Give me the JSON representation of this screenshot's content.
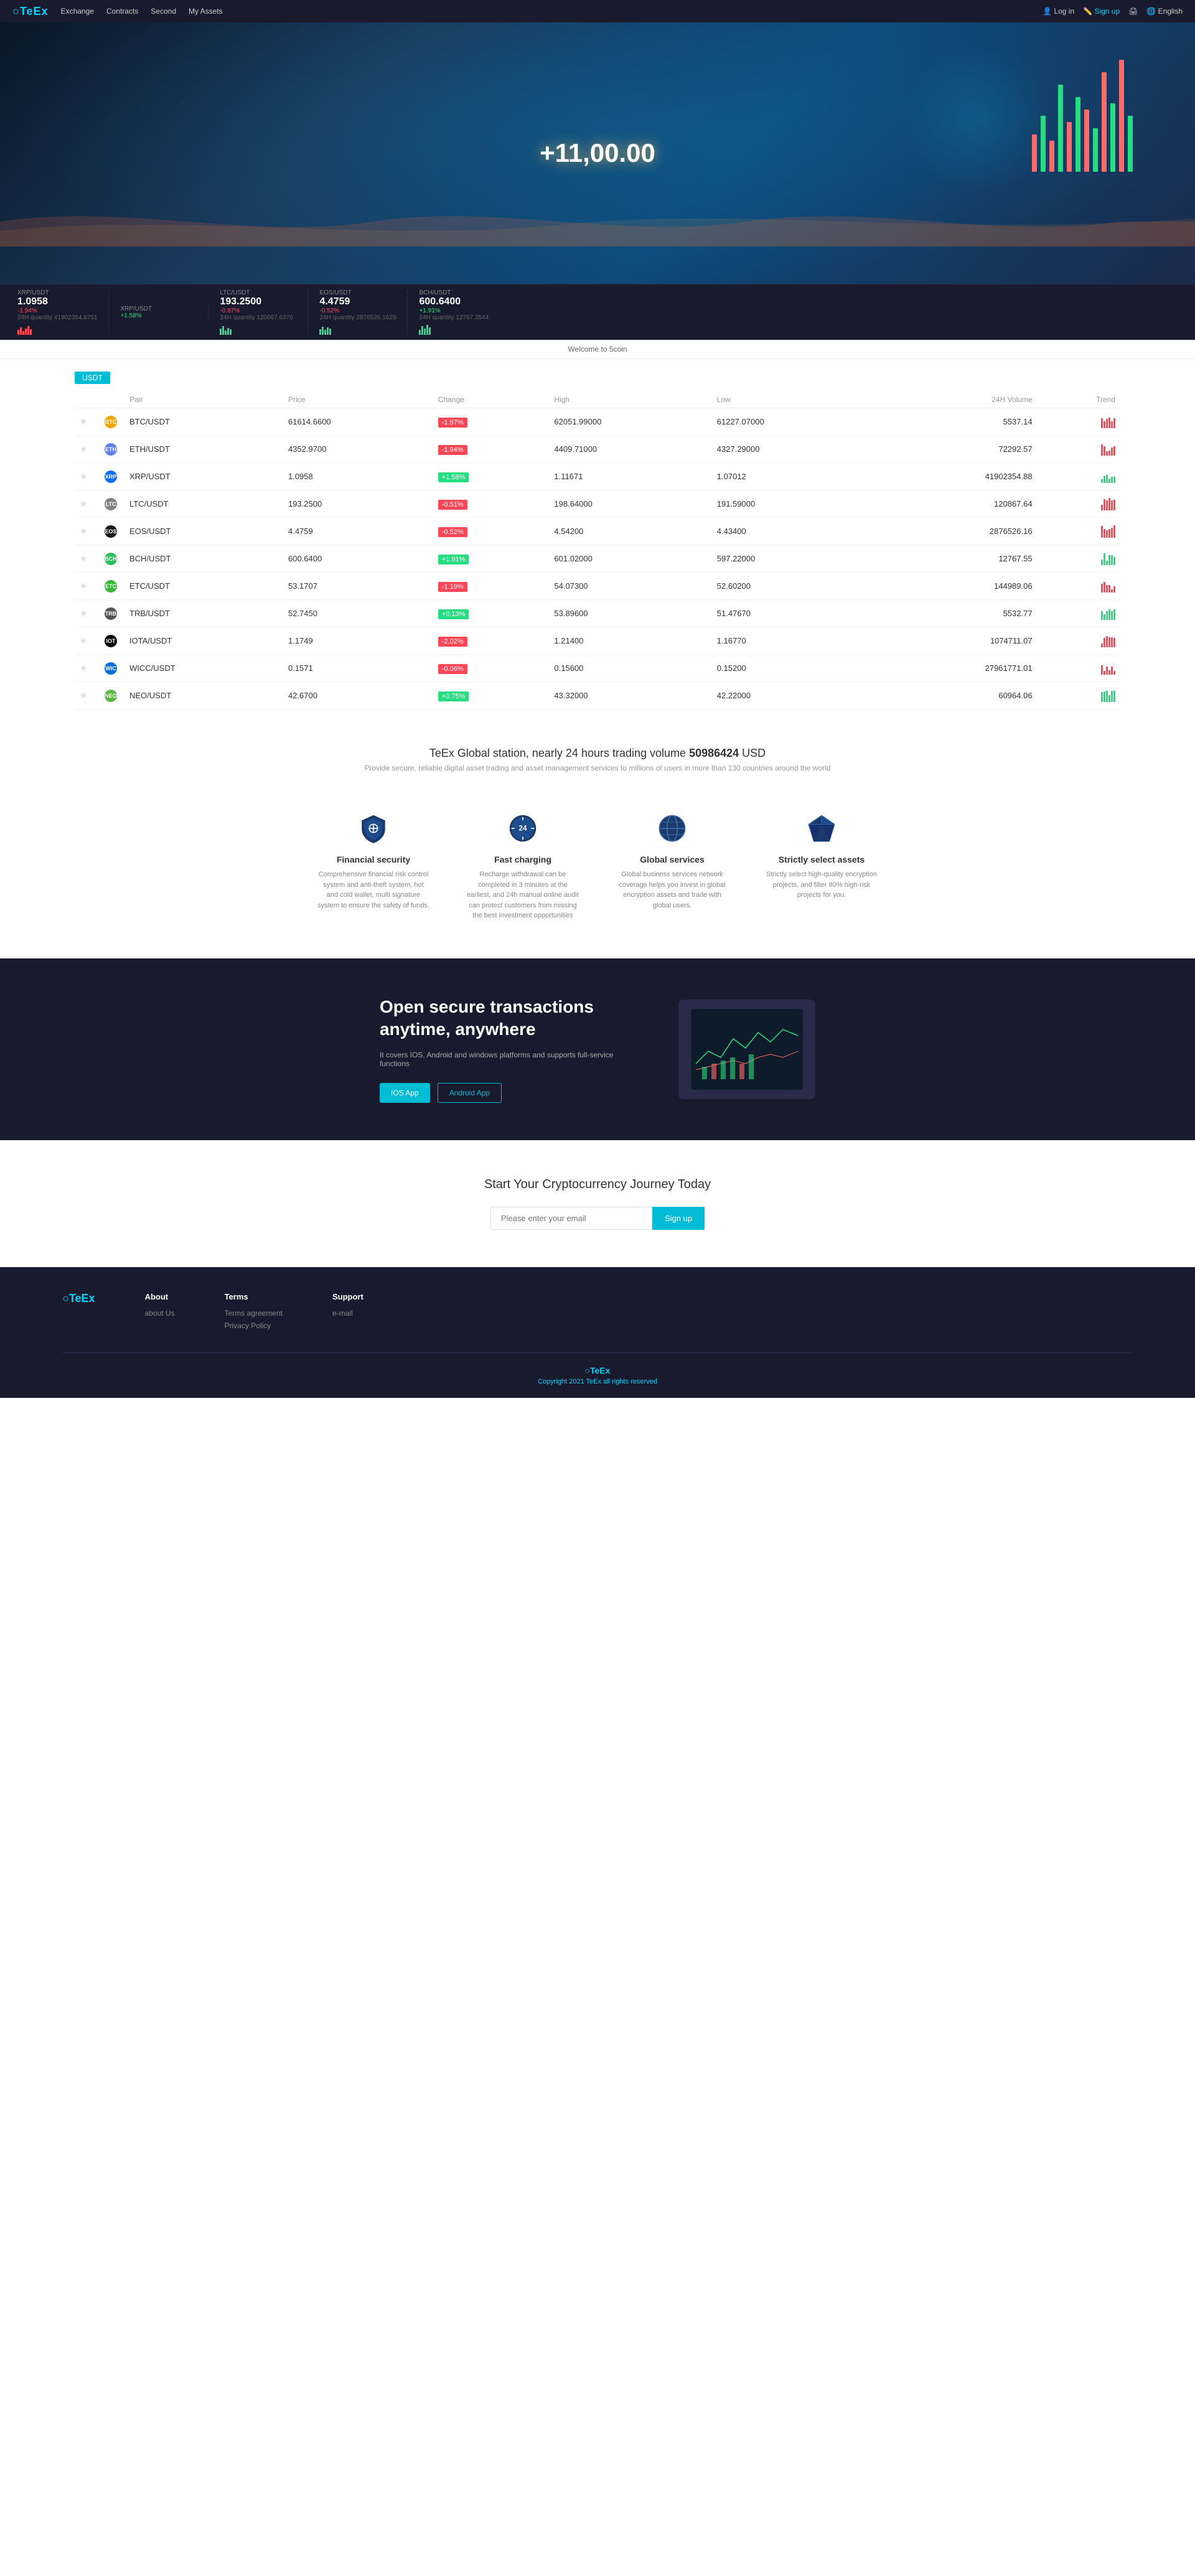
{
  "brand": {
    "logo": "○TeEx",
    "logo_colored": "TeEx"
  },
  "navbar": {
    "links": [
      "Exchange",
      "Contracts",
      "Second",
      "My Assets"
    ],
    "login": "Log in",
    "signup": "Sign up",
    "print": "🖨",
    "lang": "🌐 English"
  },
  "ticker": [
    {
      "pair": "XRP/USDT",
      "change": "-1.94%",
      "price": "1.0958",
      "vol": "24H quantity 41902354.6751",
      "pos": false
    },
    {
      "pair": "XRP/USDT",
      "change": "+1.58%",
      "price": "",
      "vol": "",
      "pos": true
    },
    {
      "pair": "LTC/USDT",
      "change": "-0.87%",
      "price": "193.2500",
      "vol": "24H quantity 120667.6376",
      "pos": false
    },
    {
      "pair": "EOS/USDT",
      "change": "-0.52%",
      "price": "4.4759",
      "vol": "24H quantity 2876526.1629",
      "pos": false
    },
    {
      "pair": "BCH/USDT",
      "change": "+1.91%",
      "price": "600.6400",
      "vol": "24H quantity 12767.3544",
      "pos": true
    }
  ],
  "welcome": "Welcome to 5coin",
  "market": {
    "tab": "USDT",
    "headers": [
      "Pair",
      "Price",
      "Change",
      "High",
      "Low",
      "24H Volume",
      "Trend"
    ],
    "rows": [
      {
        "symbol": "BTC",
        "type": "BTC",
        "price": "61614.6600",
        "change": "-1.97%",
        "high": "62051.99000",
        "low": "61227.07000",
        "vol": "5537.14",
        "pos": false
      },
      {
        "symbol": "ETH",
        "type": "ETH",
        "price": "4352.9700",
        "change": "-1.94%",
        "high": "4409.71000",
        "low": "4327.29000",
        "vol": "72292.57",
        "pos": false
      },
      {
        "symbol": "XRP",
        "type": "XRP",
        "price": "1.0958",
        "change": "+1.58%",
        "high": "1.11671",
        "low": "1.07012",
        "vol": "41902354.88",
        "pos": true
      },
      {
        "symbol": "LTC",
        "type": "LTC",
        "price": "193.2500",
        "change": "-0.51%",
        "high": "198.64000",
        "low": "191.59000",
        "vol": "120867.64",
        "pos": false
      },
      {
        "symbol": "EOS",
        "type": "EOS",
        "price": "4.4759",
        "change": "-0.52%",
        "high": "4.54200",
        "low": "4.43400",
        "vol": "2876526.16",
        "pos": false
      },
      {
        "symbol": "BCH",
        "type": "BCH",
        "price": "600.6400",
        "change": "+1.91%",
        "high": "601.02000",
        "low": "597.22000",
        "vol": "12767.55",
        "pos": true
      },
      {
        "symbol": "ETC",
        "type": "ETC",
        "price": "53.1707",
        "change": "-1.19%",
        "high": "54.07300",
        "low": "52.60200",
        "vol": "144989.06",
        "pos": false
      },
      {
        "symbol": "TRB",
        "type": "TRB",
        "price": "52.7450",
        "change": "+0.13%",
        "high": "53.89600",
        "low": "51.47670",
        "vol": "5532.77",
        "pos": true
      },
      {
        "symbol": "IOTA",
        "type": "IOTA",
        "price": "1.1749",
        "change": "-2.02%",
        "high": "1.21400",
        "low": "1.16770",
        "vol": "1074711.07",
        "pos": false
      },
      {
        "symbol": "WICC",
        "type": "WICC",
        "price": "0.1571",
        "change": "-0.06%",
        "high": "0.15600",
        "low": "0.15200",
        "vol": "27961771.01",
        "pos": false
      },
      {
        "symbol": "NEO",
        "type": "NEO",
        "price": "42.6700",
        "change": "+0.75%",
        "high": "43.32000",
        "low": "42.22000",
        "vol": "60964.06",
        "pos": true
      }
    ]
  },
  "stats": {
    "title": "TeEx Global station, nearly 24 hours trading volume",
    "volume": "50986424",
    "currency": "USD",
    "subtitle": "Provide secure, reliable digital asset trading and asset management services to millions of users in more than 130 countries around the world"
  },
  "features": [
    {
      "icon": "shield",
      "title": "Financial security",
      "desc": "Comprehensive financial risk control system and anti-theft system, hot and cold wallet, multi signature system to ensure the safety of funds."
    },
    {
      "icon": "clock24",
      "title": "Fast charging",
      "desc": "Recharge withdrawal can be completed in 3 minutes at the earliest, and 24h manual online audit can protect customers from missing the best investment opportunities"
    },
    {
      "icon": "globe",
      "title": "Global services",
      "desc": "Global business services network coverage helps you invest in global encryption assets and trade with global users."
    },
    {
      "icon": "diamond",
      "title": "Strictly select assets",
      "desc": "Strictly select high-quality encryption projects, and filter 80% high-risk projects for you."
    }
  ],
  "app_section": {
    "title": "Open secure transactions anytime, anywhere",
    "subtitle": "It covers IOS, Android and windows platforms and supports full-service functions",
    "ios_btn": "IOS App",
    "android_btn": "Android App"
  },
  "signup_section": {
    "title": "Start Your Cryptocurrency Journey Today",
    "placeholder": "Please enter your email",
    "btn": "Sign up"
  },
  "footer": {
    "logo": "○TeEx",
    "cols": [
      {
        "heading": "About",
        "links": [
          "about Us"
        ]
      },
      {
        "heading": "Terms",
        "links": [
          "Terms agreement",
          "Privacy Policy"
        ]
      },
      {
        "heading": "Support",
        "links": [
          "e-mail"
        ]
      }
    ],
    "copyright": "©TeEx",
    "copyright_text": "Copyright 2021 TeEx all rights reserved"
  }
}
